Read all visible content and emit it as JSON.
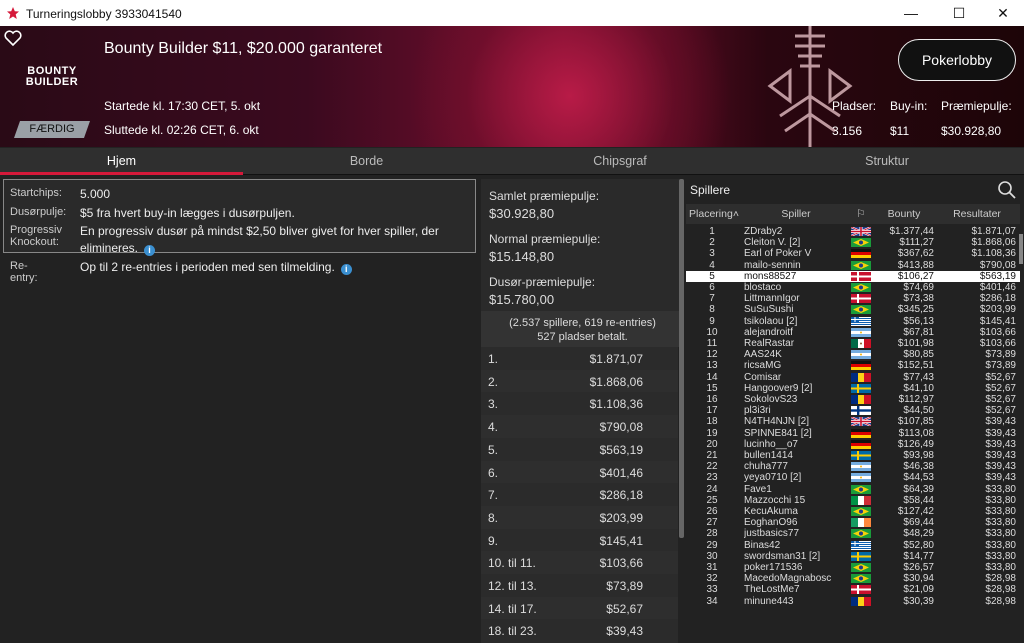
{
  "window": {
    "title": "Turneringslobby 3933041540"
  },
  "banner": {
    "logo_line1": "BOUNTY",
    "logo_line2": "BUILDER",
    "name": "Bounty Builder $11, $20.000 garanteret",
    "start": "Startede kl. 17:30 CET, 5. okt",
    "end": "Sluttede kl. 02:26 CET, 6. okt",
    "status": "FÆRDIG",
    "lobby_button": "Pokerlobby",
    "stats": {
      "seats_label": "Pladser:",
      "seats": "3.156",
      "buyin_label": "Buy-in:",
      "buyin": "$11",
      "pool_label": "Præmiepulje:",
      "pool": "$30.928,80"
    }
  },
  "tabs": [
    "Hjem",
    "Borde",
    "Chipsgraf",
    "Struktur"
  ],
  "info": {
    "startchips_label": "Startchips:",
    "startchips": "5.000",
    "bountypool_label": "Dusørpulje:",
    "bountypool": "$5 fra hvert buy-in lægges i dusørpuljen.",
    "pko_label1": "Progressiv",
    "pko_label2": "Knockout:",
    "pko": "En progressiv dusør på mindst $2,50 bliver givet for hver spiller, der",
    "pko2": "elimineres.",
    "reentry_label": "Re-entry:",
    "reentry": "Op til 2 re-entries i perioden med sen tilmelding."
  },
  "prizes": {
    "total_label": "Samlet præmiepulje:",
    "total": "$30.928,80",
    "normal_label": "Normal præmiepulje:",
    "normal": "$15.148,80",
    "bounty_label": "Dusør-præmiepulje:",
    "bounty": "$15.780,00",
    "entrants": "(2.537 spillere, 619 re-entries)",
    "paid": "527 pladser betalt.",
    "list": [
      {
        "place": "1.",
        "amount": "$1.871,07"
      },
      {
        "place": "2.",
        "amount": "$1.868,06"
      },
      {
        "place": "3.",
        "amount": "$1.108,36"
      },
      {
        "place": "4.",
        "amount": "$790,08"
      },
      {
        "place": "5.",
        "amount": "$563,19"
      },
      {
        "place": "6.",
        "amount": "$401,46"
      },
      {
        "place": "7.",
        "amount": "$286,18"
      },
      {
        "place": "8.",
        "amount": "$203,99"
      },
      {
        "place": "9.",
        "amount": "$145,41"
      },
      {
        "place": "10. til 11.",
        "amount": "$103,66"
      },
      {
        "place": "12. til 13.",
        "amount": "$73,89"
      },
      {
        "place": "14. til 17.",
        "amount": "$52,67"
      },
      {
        "place": "18. til 23.",
        "amount": "$39,43"
      }
    ]
  },
  "players": {
    "title": "Spillere",
    "col_place": "Placering",
    "col_player": "Spiller",
    "col_bounty": "Bounty",
    "col_result": "Resultater",
    "highlight_row": 5,
    "rows": [
      {
        "p": "1",
        "n": "ZDraby2",
        "f": "gb",
        "b": "$1.377,44",
        "r": "$1.871,07"
      },
      {
        "p": "2",
        "n": "Cleiton V. [2]",
        "f": "br",
        "b": "$111,27",
        "r": "$1.868,06"
      },
      {
        "p": "3",
        "n": "Earl of Poker V",
        "f": "de",
        "b": "$367,62",
        "r": "$1.108,36"
      },
      {
        "p": "4",
        "n": "mailo-sennin",
        "f": "br",
        "b": "$413,88",
        "r": "$790,08"
      },
      {
        "p": "5",
        "n": "mons88527",
        "f": "dk",
        "b": "$106,27",
        "r": "$563,19"
      },
      {
        "p": "6",
        "n": "blostaco",
        "f": "br",
        "b": "$74,69",
        "r": "$401,46"
      },
      {
        "p": "7",
        "n": "LittmannIgor",
        "f": "dk",
        "b": "$73,38",
        "r": "$286,18"
      },
      {
        "p": "8",
        "n": "SuSuSushi",
        "f": "br",
        "b": "$345,25",
        "r": "$203,99"
      },
      {
        "p": "9",
        "n": "tsikolaou [2]",
        "f": "gr",
        "b": "$56,13",
        "r": "$145,41"
      },
      {
        "p": "10",
        "n": "alejandroitf",
        "f": "ar",
        "b": "$67,81",
        "r": "$103,66"
      },
      {
        "p": "11",
        "n": "RealRastar",
        "f": "mx",
        "b": "$101,98",
        "r": "$103,66"
      },
      {
        "p": "12",
        "n": "AAS24K",
        "f": "ar",
        "b": "$80,85",
        "r": "$73,89"
      },
      {
        "p": "13",
        "n": "ricsaMG",
        "f": "de",
        "b": "$152,51",
        "r": "$73,89"
      },
      {
        "p": "14",
        "n": "Comisar",
        "f": "ro",
        "b": "$77,43",
        "r": "$52,67"
      },
      {
        "p": "15",
        "n": "Hangoover9 [2]",
        "f": "se",
        "b": "$41,10",
        "r": "$52,67"
      },
      {
        "p": "16",
        "n": "SokolovS23",
        "f": "ro",
        "b": "$112,97",
        "r": "$52,67"
      },
      {
        "p": "17",
        "n": "pl3i3ri",
        "f": "fi",
        "b": "$44,50",
        "r": "$52,67"
      },
      {
        "p": "18",
        "n": "N4TH4NJN [2]",
        "f": "gb",
        "b": "$107,85",
        "r": "$39,43"
      },
      {
        "p": "19",
        "n": "SPINNE841 [2]",
        "f": "de",
        "b": "$113,08",
        "r": "$39,43"
      },
      {
        "p": "20",
        "n": "lucinho__o7",
        "f": "de",
        "b": "$126,49",
        "r": "$39,43"
      },
      {
        "p": "21",
        "n": "bullen1414",
        "f": "se",
        "b": "$93,98",
        "r": "$39,43"
      },
      {
        "p": "22",
        "n": "chuha777",
        "f": "ar",
        "b": "$46,38",
        "r": "$39,43"
      },
      {
        "p": "23",
        "n": "yeya0710 [2]",
        "f": "ar",
        "b": "$44,53",
        "r": "$39,43"
      },
      {
        "p": "24",
        "n": "Fave1",
        "f": "br",
        "b": "$64,39",
        "r": "$33,80"
      },
      {
        "p": "25",
        "n": "Mazzocchi 15",
        "f": "it",
        "b": "$58,44",
        "r": "$33,80"
      },
      {
        "p": "26",
        "n": "KecuAkuma",
        "f": "br",
        "b": "$127,42",
        "r": "$33,80"
      },
      {
        "p": "27",
        "n": "EoghanO96",
        "f": "ie",
        "b": "$69,44",
        "r": "$33,80"
      },
      {
        "p": "28",
        "n": "justbasics77",
        "f": "br",
        "b": "$48,29",
        "r": "$33,80"
      },
      {
        "p": "29",
        "n": "Binas42",
        "f": "gr",
        "b": "$52,80",
        "r": "$33,80"
      },
      {
        "p": "30",
        "n": "swordsman31 [2]",
        "f": "se",
        "b": "$14,77",
        "r": "$33,80"
      },
      {
        "p": "31",
        "n": "poker171536",
        "f": "br",
        "b": "$26,57",
        "r": "$33,80"
      },
      {
        "p": "32",
        "n": "MacedoMagnabosc",
        "f": "br",
        "b": "$30,94",
        "r": "$28,98"
      },
      {
        "p": "33",
        "n": "TheLostMe7",
        "f": "dk",
        "b": "$21,09",
        "r": "$28,98"
      },
      {
        "p": "34",
        "n": "minune443",
        "f": "ro",
        "b": "$30,39",
        "r": "$28,98"
      }
    ]
  }
}
